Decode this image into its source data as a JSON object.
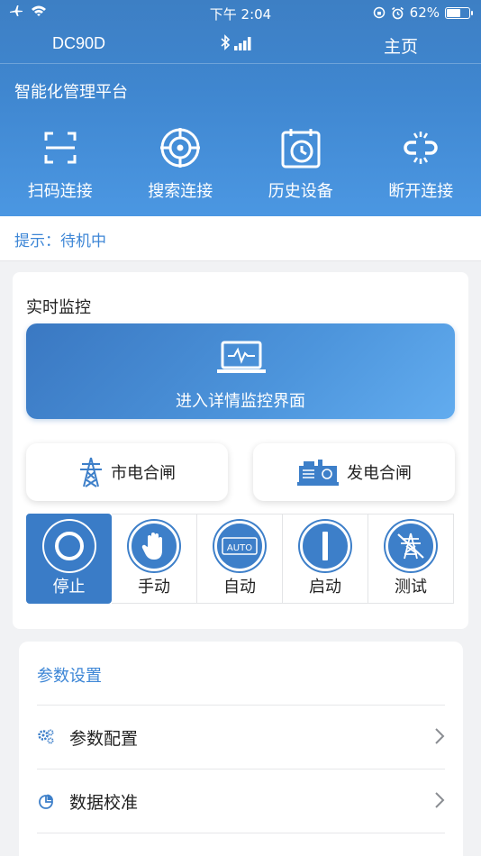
{
  "status_bar": {
    "time": "下午 2:04",
    "battery": "62%",
    "battery_level": 0.62
  },
  "navbar": {
    "device": "DC90D",
    "home": "主页"
  },
  "platform_title": "智能化管理平台",
  "actions": [
    {
      "label": "扫码连接",
      "icon": "scan-icon"
    },
    {
      "label": "搜索连接",
      "icon": "search-target-icon"
    },
    {
      "label": "历史设备",
      "icon": "history-icon"
    },
    {
      "label": "断开连接",
      "icon": "disconnect-icon"
    }
  ],
  "tip": "提示：待机中",
  "monitor": {
    "title": "实时监控",
    "enter_label": "进入详情监控界面",
    "mains_switch": "市电合闸",
    "gen_switch": "发电合闸",
    "modes": [
      {
        "label": "停止",
        "active": true
      },
      {
        "label": "手动"
      },
      {
        "label": "自动",
        "badge": "AUTO"
      },
      {
        "label": "启动"
      },
      {
        "label": "测试"
      }
    ]
  },
  "params": {
    "title": "参数设置",
    "items": [
      {
        "label": "参数配置",
        "icon": "gears-icon"
      },
      {
        "label": "数据校准",
        "icon": "pie-chart-icon"
      }
    ]
  },
  "colors": {
    "primary": "#3d86d6",
    "hero_top": "#3d7fc4",
    "hero_bottom": "#4b97e2"
  }
}
